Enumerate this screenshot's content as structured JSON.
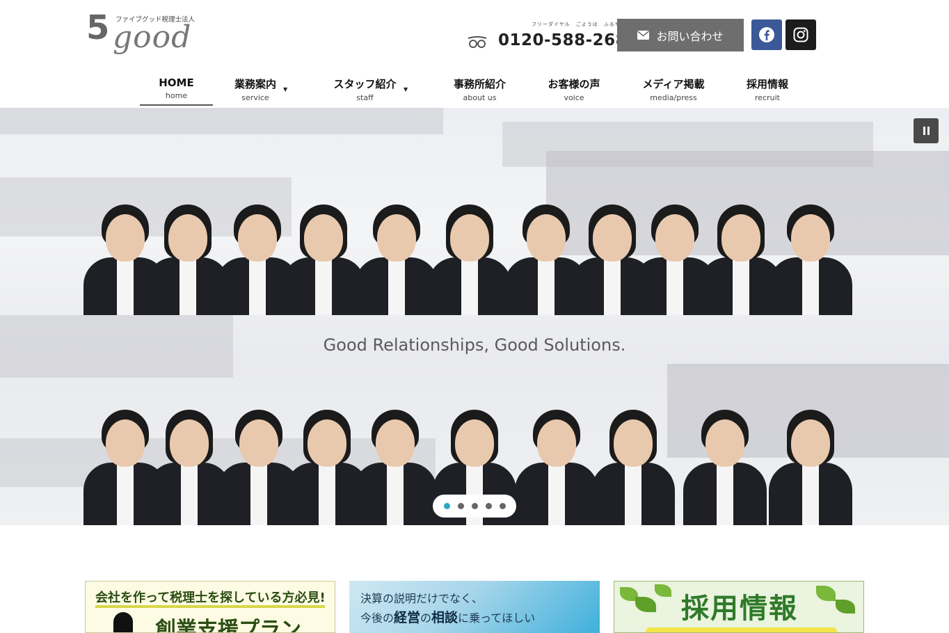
{
  "header": {
    "logo_number": "5",
    "logo_word": "good",
    "logo_subtitle": "ファイブグッド税理士法人",
    "freedial_label": "フリーダイヤル　ごようは　ふるや",
    "phone": "0120-588-268",
    "contact_label": "お問い合わせ",
    "icons": [
      "freedial-icon",
      "mail-icon",
      "facebook-icon",
      "instagram-icon"
    ],
    "colors": {
      "contact_bg": "#6e6e6e",
      "facebook_bg": "#3b5998",
      "instagram_bg": "#1c1c1c"
    }
  },
  "nav": {
    "items": [
      {
        "jp": "HOME",
        "en": "home",
        "active": true
      },
      {
        "jp": "業務案内",
        "en": "service",
        "dropdown": true
      },
      {
        "jp": "スタッフ紹介",
        "en": "staff",
        "dropdown": true
      },
      {
        "jp": "事務所紹介",
        "en": "about us"
      },
      {
        "jp": "お客様の声",
        "en": "voice"
      },
      {
        "jp": "メディア掲載",
        "en": "media/press"
      },
      {
        "jp": "採用情報",
        "en": "recruit"
      }
    ]
  },
  "hero": {
    "tagline": "Good Relationships, Good Solutions.",
    "slide_count": 5,
    "active_slide": 1,
    "pause_icon": "pause-icon",
    "dot_active_color": "#2aa7c9"
  },
  "banners": {
    "startup": {
      "headline": "会社を作って税理士を探している方必見!",
      "title": "創業支援プラン"
    },
    "consult": {
      "line1": "決算の説明だけでなく、",
      "line2_pre": "今後の",
      "line2_b1": "経営",
      "line2_mid": "の",
      "line2_b2": "相談",
      "line2_post": "に乗ってほしい"
    },
    "recruit": {
      "title": "採用情報"
    }
  }
}
